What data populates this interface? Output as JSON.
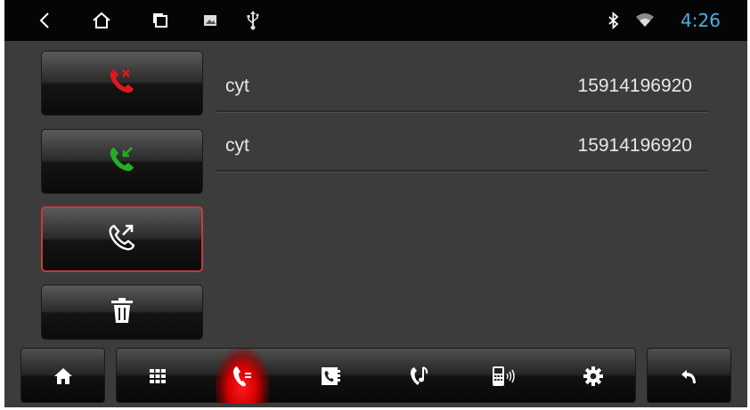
{
  "status_bar": {
    "time": "4:26",
    "icons": [
      "back-icon",
      "home-icon",
      "recents-icon",
      "gallery-icon",
      "usb-icon",
      "bluetooth-icon",
      "wifi-icon"
    ],
    "clock_color": "#4ab0e6"
  },
  "call_actions": [
    "missed-call-icon",
    "received-call-icon",
    "dialed-call-icon",
    "trash-icon"
  ],
  "selected_action": "dialed-call-icon",
  "call_log": [
    {
      "name": "cyt",
      "number": "15914196920"
    },
    {
      "name": "cyt",
      "number": "15914196920"
    }
  ],
  "bottom_nav": {
    "items": [
      "dialpad-icon",
      "call-log-icon",
      "contacts-icon",
      "music-icon",
      "phone-settings-icon",
      "gear-icon"
    ],
    "active": "call-log-icon"
  },
  "colors": {
    "missed": "#e01818",
    "received": "#22b022",
    "accent": "#c83a3a"
  }
}
